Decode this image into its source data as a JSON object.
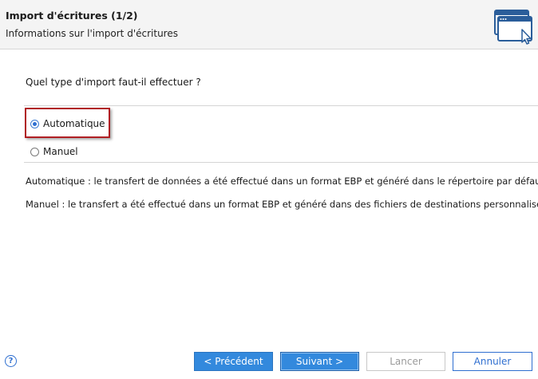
{
  "header": {
    "title": "Import d'écritures (1/2)",
    "subtitle": "Informations sur l'import d'écritures",
    "icon": "window-cursor-icon"
  },
  "question": "Quel type d'import faut-il effectuer ?",
  "options": [
    {
      "label": "Automatique",
      "selected": true
    },
    {
      "label": "Manuel",
      "selected": false
    }
  ],
  "descriptions": {
    "automatic": "Automatique : le transfert de données a été effectué dans un format EBP et généré dans le répertoire par défaut.",
    "manual": "Manuel : le transfert a été effectué dans un format EBP et généré dans des fichiers de destinations personnalisés."
  },
  "footer": {
    "help_icon": "?",
    "previous_label": "< Précédent",
    "next_label": "Suivant >",
    "launch_label": "Lancer",
    "cancel_label": "Annuler"
  },
  "colors": {
    "accent": "#3389dd",
    "highlight": "#b01e23"
  }
}
